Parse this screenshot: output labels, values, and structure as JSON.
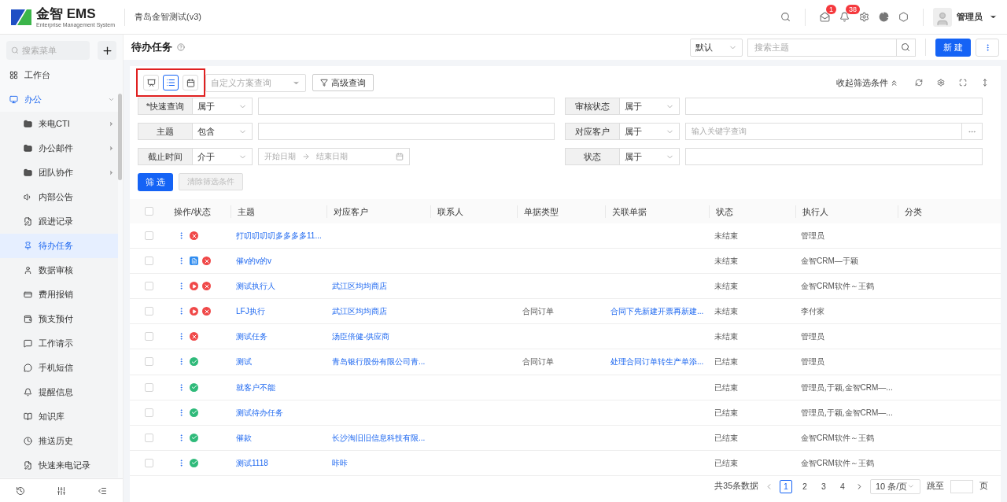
{
  "header": {
    "logo_title": "金智 EMS",
    "logo_subtitle": "Enterprise Management System",
    "company": "青岛金智测试(v3)",
    "badges": [
      {
        "kind": "mail",
        "count": "1"
      },
      {
        "kind": "bell",
        "count": "38"
      }
    ],
    "user": "管理员"
  },
  "sidebar": {
    "search_placeholder": "搜索菜单",
    "items": [
      {
        "label": "工作台",
        "selected": false
      },
      {
        "label": "办公",
        "selected": false,
        "expanded": true,
        "children": [
          {
            "label": "来电CTI",
            "selected": false,
            "expandable": true
          },
          {
            "label": "办公邮件",
            "selected": false,
            "expandable": true
          },
          {
            "label": "团队协作",
            "selected": false,
            "expandable": true
          },
          {
            "label": "内部公告",
            "selected": false,
            "expandable": false
          },
          {
            "label": "跟进记录",
            "selected": false,
            "expandable": false
          },
          {
            "label": "待办任务",
            "selected": true,
            "expandable": false
          },
          {
            "label": "数据审核",
            "selected": false,
            "expandable": false
          },
          {
            "label": "费用报销",
            "selected": false,
            "expandable": false
          },
          {
            "label": "预支预付",
            "selected": false,
            "expandable": false
          },
          {
            "label": "工作请示",
            "selected": false,
            "expandable": false
          },
          {
            "label": "手机短信",
            "selected": false,
            "expandable": false
          },
          {
            "label": "提醒信息",
            "selected": false,
            "expandable": false
          },
          {
            "label": "知识库",
            "selected": false,
            "expandable": false
          },
          {
            "label": "推送历史",
            "selected": false,
            "expandable": false
          },
          {
            "label": "快速来电记录",
            "selected": false,
            "expandable": false
          }
        ]
      }
    ]
  },
  "page": {
    "title": "待办任务",
    "sort_select": "默认",
    "search_placeholder": "搜索主题",
    "new_button": "新 建"
  },
  "toolbar": {
    "highlighted": true,
    "view_modes": [
      {
        "kind": "board",
        "selected": false
      },
      {
        "kind": "list",
        "selected": true
      },
      {
        "kind": "calendar",
        "selected": false
      }
    ],
    "scheme_placeholder": "自定义方案查询",
    "advanced_button": "高级查询",
    "collapse_link": "收起筛选条件"
  },
  "filters": {
    "left": [
      {
        "kind": "text",
        "label": "*快速查询",
        "operator": "属于"
      },
      {
        "kind": "text",
        "label": "主题",
        "operator": "包含"
      },
      {
        "kind": "date_range",
        "label": "截止时间",
        "operator": "介于",
        "start_placeholder": "开始日期",
        "end_placeholder": "结束日期"
      }
    ],
    "right": [
      {
        "kind": "text",
        "label": "审核状态",
        "operator": "属于"
      },
      {
        "kind": "lookup",
        "label": "对应客户",
        "operator": "属于",
        "placeholder": "输入关键字查询"
      },
      {
        "kind": "text",
        "label": "状态",
        "operator": "属于"
      }
    ],
    "filter_button": "筛 选",
    "clear_button": "清除筛选条件",
    "clear_disabled": true
  },
  "table": {
    "select_all": false,
    "columns": [
      "操作/状态",
      "主题",
      "对应客户",
      "联系人",
      "单据类型",
      "关联单据",
      "状态",
      "执行人",
      "分类"
    ],
    "rows": [
      {
        "checked": false,
        "icons": [
          {
            "kind": "cancel"
          }
        ],
        "subject": "打叨叨叨叨多多多多11...",
        "status": "未结束",
        "executor": "管理员"
      },
      {
        "checked": false,
        "icons": [
          {
            "kind": "doc"
          },
          {
            "kind": "cancel"
          }
        ],
        "subject": "催v的v的v",
        "status": "未结束",
        "executor": "金智CRM—于颖"
      },
      {
        "checked": false,
        "icons": [
          {
            "kind": "play"
          },
          {
            "kind": "cancel"
          }
        ],
        "subject": "测试执行人",
        "customer": "武江区均均商店",
        "status": "未结束",
        "executor": "金智CRM软件～王鹤"
      },
      {
        "checked": false,
        "icons": [
          {
            "kind": "play"
          },
          {
            "kind": "cancel"
          }
        ],
        "subject": "LFJ执行",
        "customer": "武江区均均商店",
        "doc_type": "合同订单",
        "related": "合同下先新建开票再新建...",
        "status": "未结束",
        "executor": "李付家"
      },
      {
        "checked": false,
        "icons": [
          {
            "kind": "cancel"
          }
        ],
        "subject": "测试任务",
        "customer": "汤臣倍健-供应商",
        "status": "未结束",
        "executor": "管理员"
      },
      {
        "checked": false,
        "icons": [
          {
            "kind": "check"
          }
        ],
        "subject": "测试",
        "customer": "青岛银行股份有限公司青...",
        "doc_type": "合同订单",
        "related": "处理合同订单转生产单添...",
        "status": "已结束",
        "executor": "管理员"
      },
      {
        "checked": false,
        "icons": [
          {
            "kind": "check"
          }
        ],
        "subject": "就客户不能",
        "status": "已结束",
        "executor": "管理员,于颖,金智CRM—..."
      },
      {
        "checked": false,
        "icons": [
          {
            "kind": "check"
          }
        ],
        "subject": "测试待办任务",
        "status": "已结束",
        "executor": "管理员,于颖,金智CRM—..."
      },
      {
        "checked": false,
        "icons": [
          {
            "kind": "check"
          }
        ],
        "subject": "催款",
        "customer": "长沙淘旧旧信息科技有限...",
        "status": "已结束",
        "executor": "金智CRM软件～王鹤"
      },
      {
        "checked": false,
        "icons": [
          {
            "kind": "check"
          }
        ],
        "subject": "测试1118",
        "customer": "咔咔",
        "status": "已结束",
        "executor": "金智CRM软件～王鹤"
      }
    ]
  },
  "pagination": {
    "total": "共35条数据",
    "pages": [
      {
        "label": "1",
        "selected": true
      },
      {
        "label": "2",
        "selected": false
      },
      {
        "label": "3",
        "selected": false
      },
      {
        "label": "4",
        "selected": false
      }
    ],
    "page_size": "10 条/页",
    "jump_label": "跳至",
    "page_unit": "页"
  }
}
